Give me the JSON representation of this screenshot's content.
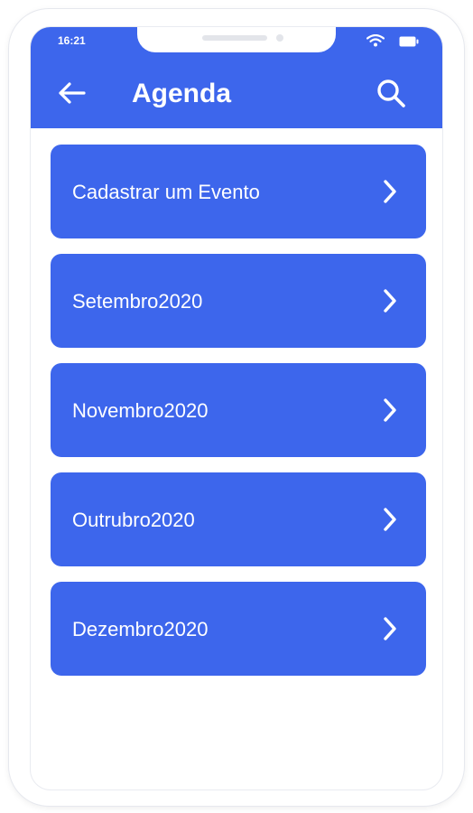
{
  "colors": {
    "primary": "#3d66ec",
    "text_on_primary": "#ffffff",
    "background": "#ffffff"
  },
  "status_bar": {
    "time": "16:21",
    "icons": [
      "wifi-icon",
      "battery-icon"
    ]
  },
  "header": {
    "back_icon": "arrow-left-icon",
    "title": "Agenda",
    "search_icon": "search-icon"
  },
  "menu": {
    "items": [
      {
        "label": "Cadastrar um Evento",
        "icon": "chevron-right-icon"
      },
      {
        "label": "Setembro2020",
        "icon": "chevron-right-icon"
      },
      {
        "label": "Novembro2020",
        "icon": "chevron-right-icon"
      },
      {
        "label": "Outrubro2020",
        "icon": "chevron-right-icon"
      },
      {
        "label": "Dezembro2020",
        "icon": "chevron-right-icon"
      }
    ]
  }
}
